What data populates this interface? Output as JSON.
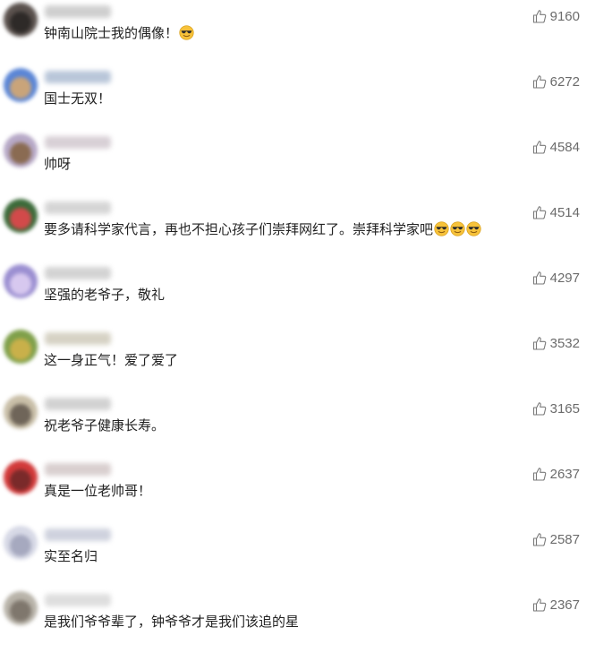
{
  "icon_names": {
    "like": "thumbs-up-icon",
    "emoji": "sunglasses-emoji-icon"
  },
  "colors": {
    "text": "#222222",
    "count": "#6b6b6b",
    "background": "#ffffff"
  },
  "comments": [
    {
      "text": "钟南山院士我的偶像！",
      "likes": "9160",
      "emoji_count": 1,
      "avatar": [
        "#5b524e",
        "#2e2a28"
      ],
      "name_color": "#cfcfcf"
    },
    {
      "text": "国士无双！",
      "likes": "6272",
      "emoji_count": 0,
      "avatar": [
        "#5b86d6",
        "#c9a47a"
      ],
      "name_color": "#b9c6d9"
    },
    {
      "text": "帅呀",
      "likes": "4584",
      "emoji_count": 0,
      "avatar": [
        "#b7a9c7",
        "#8a6b52"
      ],
      "name_color": "#d8d0d6"
    },
    {
      "text": "要多请科学家代言，再也不担心孩子们崇拜网红了。崇拜科学家吧",
      "likes": "4514",
      "emoji_count": 3,
      "avatar": [
        "#3c6b3a",
        "#d24a4a"
      ],
      "name_color": "#d5d5d5"
    },
    {
      "text": "坚强的老爷子，敬礼",
      "likes": "4297",
      "emoji_count": 0,
      "avatar": [
        "#9b8fd1",
        "#d7c8ef"
      ],
      "name_color": "#d3d3d3"
    },
    {
      "text": "这一身正气！爱了爱了",
      "likes": "3532",
      "emoji_count": 0,
      "avatar": [
        "#7fa04a",
        "#c9b04a"
      ],
      "name_color": "#d6d2c4"
    },
    {
      "text": "祝老爷子健康长寿。",
      "likes": "3165",
      "emoji_count": 0,
      "avatar": [
        "#c9bfa8",
        "#6f6559"
      ],
      "name_color": "#d2d2d2"
    },
    {
      "text": "真是一位老帅哥！",
      "likes": "2637",
      "emoji_count": 0,
      "avatar": [
        "#d23a3a",
        "#7a2a2a"
      ],
      "name_color": "#d9cfcf"
    },
    {
      "text": "实至名归",
      "likes": "2587",
      "emoji_count": 0,
      "avatar": [
        "#d7d9e6",
        "#a6a9bf"
      ],
      "name_color": "#cfd2de"
    },
    {
      "text": "是我们爷爷辈了，钟爷爷才是我们该追的星",
      "likes": "2367",
      "emoji_count": 0,
      "avatar": [
        "#b9b4aa",
        "#7f776d"
      ],
      "name_color": "#dedede"
    }
  ]
}
